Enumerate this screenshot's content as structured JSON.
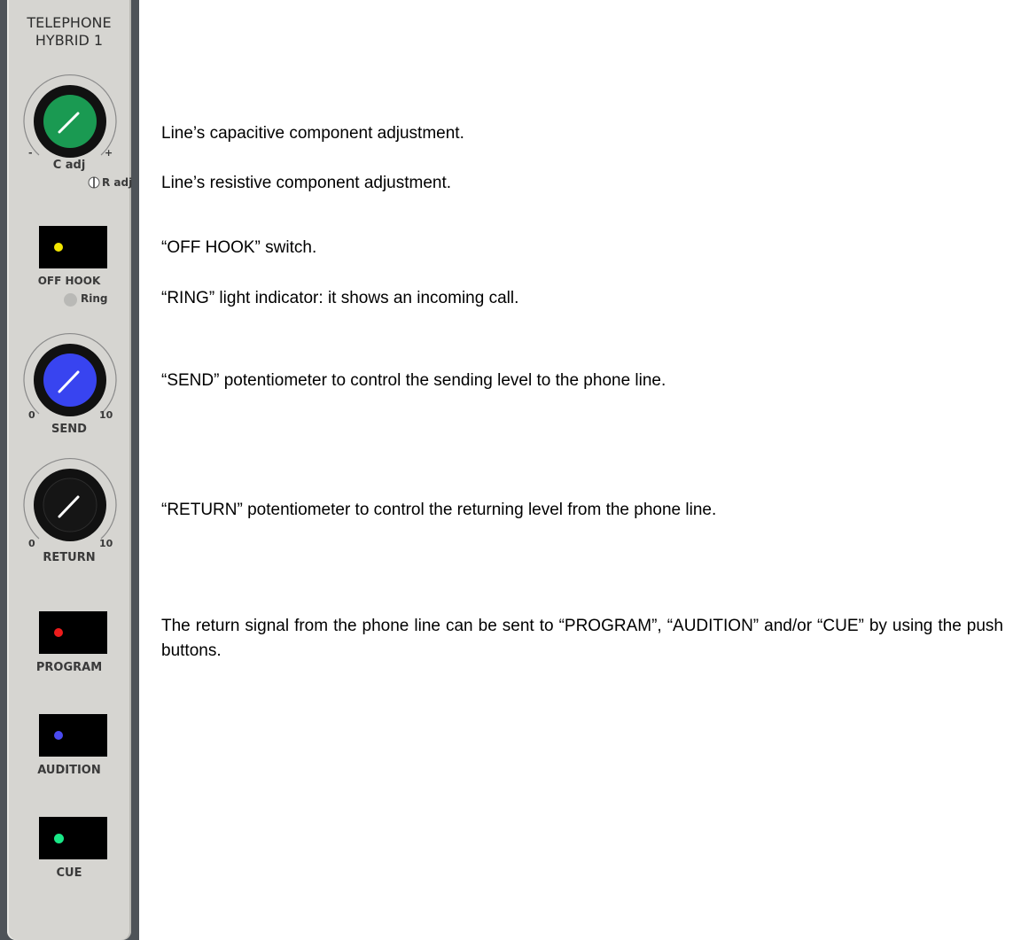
{
  "strip": {
    "title_line1": "TELEPHONE",
    "title_line2": "HYBRID 1",
    "c_adj": {
      "label": "C adj",
      "min_label": "-",
      "max_label": "+",
      "color": "#1a9a52"
    },
    "r_adj": {
      "label": "R adj"
    },
    "off_hook": {
      "label": "OFF HOOK",
      "led_color": "#f2e600"
    },
    "ring": {
      "label": "Ring",
      "led_color": "#b9b9b6"
    },
    "send": {
      "label": "SEND",
      "min_label": "0",
      "max_label": "10",
      "color": "#3844f0"
    },
    "return": {
      "label": "RETURN",
      "min_label": "0",
      "max_label": "10",
      "color": "#151515"
    },
    "program": {
      "label": "PROGRAM",
      "led_color": "#ee1c1c"
    },
    "audition": {
      "label": "AUDITION",
      "led_color": "#4a4af0"
    },
    "cue": {
      "label": "CUE",
      "led_color": "#19e887"
    }
  },
  "descriptions": {
    "c_adj": "Line’s capacitive component adjustment.",
    "r_adj": "Line’s resistive component adjustment.",
    "off_hook": "“OFF HOOK” switch.",
    "ring": "“RING” light indicator: it shows an incoming call.",
    "send": "“SEND” potentiometer to control the sending level to the phone line.",
    "return": "“RETURN” potentiometer to control the returning level from the phone line.",
    "routing": "The return signal from the phone line can be sent to “PROGRAM”, “AUDITION” and/or “CUE” by using the push buttons."
  }
}
